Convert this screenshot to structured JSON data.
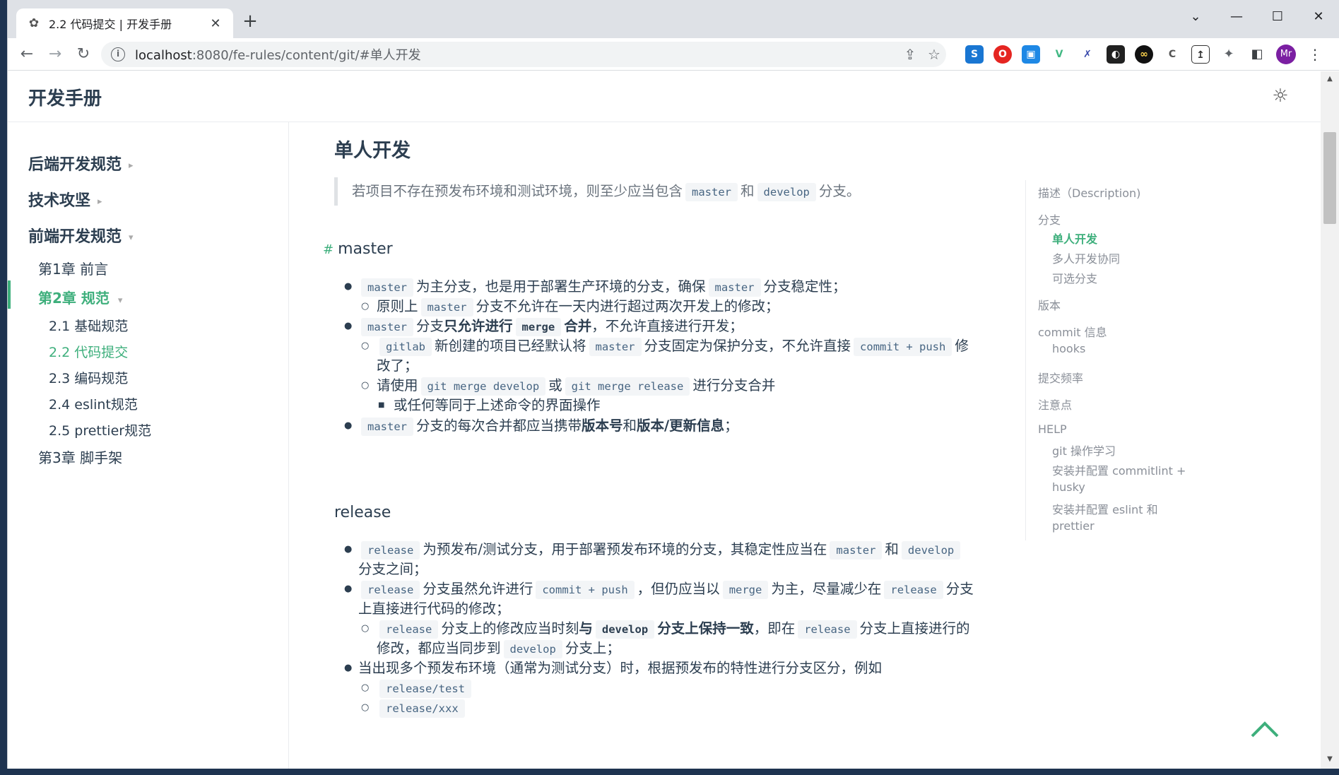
{
  "browser": {
    "tab_title": "2.2 代码提交 | 开发手册",
    "url_host": "localhost",
    "url_rest": ":8080/fe-rules/content/git/#单人开发",
    "profile_initials": "Mr",
    "new_tab_glyph": "+",
    "close_glyph": "✕"
  },
  "header": {
    "site_title": "开发手册"
  },
  "sidebar": {
    "groups": [
      {
        "label": "后端开发规范",
        "arrow": "▸"
      },
      {
        "label": "技术攻坚",
        "arrow": "▸"
      },
      {
        "label": "前端开发规范",
        "arrow": "▾"
      }
    ],
    "chapters": [
      {
        "label": "第1章 前言"
      },
      {
        "label": "第2章 规范",
        "arrow": "▾"
      },
      {
        "label": "第3章 脚手架"
      }
    ],
    "sections": [
      {
        "label": "2.1 基础规范"
      },
      {
        "label": "2.2 代码提交"
      },
      {
        "label": "2.3 编码规范"
      },
      {
        "label": "2.4 eslint规范"
      },
      {
        "label": "2.5 prettier规范"
      }
    ]
  },
  "content": {
    "title": "单人开发",
    "quote": {
      "t1": "若项目不存在预发布环境和测试环境，则至少应当包含",
      "c1": "master",
      "t2": "和",
      "c2": "develop",
      "t3": "分支。"
    },
    "master": {
      "heading": "master",
      "anchor": "#",
      "l1": {
        "c1": "master",
        "t1": "为主分支，也是用于部署生产环境的分支，确保",
        "c2": "master",
        "t2": "分支稳定性；"
      },
      "l2": {
        "t1": "原则上",
        "c1": "master",
        "t2": "分支不允许在一天内进行超过两次开发上的修改；"
      },
      "l3": {
        "c1": "master",
        "t1": "分支",
        "b1": "只允许进行",
        "c2": "merge",
        "b2": "合并",
        "t2": "，不允许直接进行开发；"
      },
      "l4": {
        "c1": "gitlab",
        "t1": "新创建的项目已经默认将",
        "c2": "master",
        "t2": "分支固定为保护分支，不允许直接",
        "c3": "commit + push",
        "t3": "修"
      },
      "l4b": "改了；",
      "l5": {
        "t1": "请使用",
        "c1": "git merge develop",
        "t2": "或",
        "c2": "git merge release",
        "t3": "进行分支合并"
      },
      "l6": "或任何等同于上述命令的界面操作",
      "l7": {
        "c1": "master",
        "t1": "分支的每次合并都应当携带",
        "b1": "版本号",
        "t2": "和",
        "b2": "版本/更新信息",
        "t3": "；"
      }
    },
    "release": {
      "heading": "release",
      "l1": {
        "c1": "release",
        "t1": "为预发布/测试分支，用于部署预发布环境的分支，其稳定性应当在",
        "c2": "master",
        "t2": "和",
        "c3": "develop"
      },
      "l1b": "分支之间；",
      "l2": {
        "c1": "release",
        "t1": "分支虽然允许进行",
        "c2": "commit + push",
        "t2": "，但仍应当以",
        "c3": "merge",
        "t3": "为主，尽量减少在",
        "c4": "release",
        "t4": "分支"
      },
      "l2b": "上直接进行代码的修改；",
      "l3": {
        "c1": "release",
        "t1": "分支上的修改应当时刻",
        "b1": "与",
        "c2": "develop",
        "b2": "分支上保持一致",
        "t2": "，即在",
        "c3": "release",
        "t3": "分支上直接进行的"
      },
      "l3b": {
        "t1": "修改，都应当同步到",
        "c1": "develop",
        "t2": "分支上；"
      },
      "l4": "当出现多个预发布环境（通常为测试分支）时，根据预发布的特性进行分支区分，例如",
      "l5": "release/test",
      "l6": "release/xxx"
    }
  },
  "toc": {
    "items": [
      "描述（Description)",
      "分支",
      "单人开发",
      "多人开发协同",
      "可选分支",
      "版本",
      "commit 信息",
      "hooks",
      "提交频率",
      "注意点",
      "HELP",
      "git 操作学习",
      "安装并配置 commitlint +",
      "husky",
      "安装并配置 eslint 和",
      "prettier"
    ]
  },
  "colors": {
    "accent": "#3eaf7c",
    "text": "#2c3e50",
    "code_text": "#476582",
    "code_bg": "#f3f5f7",
    "tabstrip": "#dee1e6"
  }
}
